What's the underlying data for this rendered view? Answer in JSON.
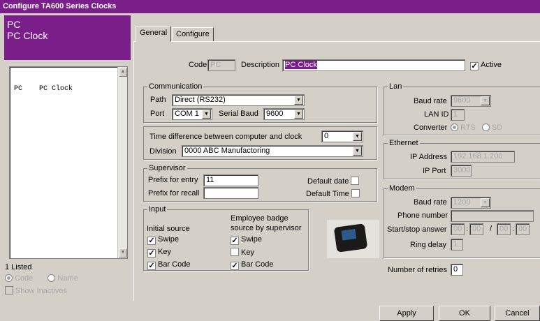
{
  "title": "Configure TA600 Series Clocks",
  "header": {
    "line1": "PC",
    "line2": "PC Clock"
  },
  "list": {
    "items": [
      "PC    PC Clock"
    ]
  },
  "left": {
    "listed": "1 Listed",
    "sort_code": "Code",
    "sort_name": "Name",
    "show_inactives": "Show Inactives"
  },
  "tabs": [
    "General",
    "Configure"
  ],
  "general": {
    "code_label": "Code",
    "code_value": "PC",
    "desc_label": "Description",
    "desc_value": "PC Clock",
    "active_label": "Active",
    "communication": {
      "title": "Communication",
      "path_label": "Path",
      "path_value": "Direct (RS232)",
      "port_label": "Port",
      "port_value": "COM 1",
      "baud_label": "Serial Baud",
      "baud_value": "9600"
    },
    "time": {
      "diff_label": "Time difference between computer and clock",
      "diff_value": "0",
      "division_label": "Division",
      "division_value": "0000  ABC Manufactoring"
    },
    "supervisor": {
      "title": "Supervisor",
      "entry_label": "Prefix for entry",
      "entry_value": "11",
      "recall_label": "Prefix for recall",
      "recall_value": "",
      "default_date": "Default date",
      "default_time": "Default Time"
    },
    "input": {
      "title": "Input",
      "initial_label": "Initial source",
      "badge_label1": "Employee badge",
      "badge_label2": "source by supervisor",
      "initial": [
        {
          "label": "Swipe",
          "checked": true
        },
        {
          "label": "Key",
          "checked": true
        },
        {
          "label": "Bar Code",
          "checked": true
        }
      ],
      "supervisor": [
        {
          "label": "Swipe",
          "checked": true
        },
        {
          "label": "Key",
          "checked": false
        },
        {
          "label": "Bar Code",
          "checked": true
        }
      ]
    },
    "lan": {
      "title": "Lan",
      "baud_label": "Baud rate",
      "baud_value": "9600",
      "id_label": "LAN ID",
      "id_value": "1",
      "conv_label": "Converter",
      "conv_rts": "RTS",
      "conv_sd": "SD"
    },
    "ethernet": {
      "title": "Ethernet",
      "ip_label": "IP Address",
      "ip_value": "192.168.1.200",
      "port_label": "IP Port",
      "port_value": "3000"
    },
    "modem": {
      "title": "Modem",
      "baud_label": "Baud rate",
      "baud_value": "1200",
      "phone_label": "Phone number",
      "phone_value": "",
      "ss_label": "Start/stop answer",
      "ss_h1": "00",
      "ss_m1": "00",
      "ss_sep": "/",
      "ss_h2": "00",
      "ss_m2": "00",
      "ring_label": "Ring delay",
      "ring_value": "1"
    },
    "retries_label": "Number of retries",
    "retries_value": "0"
  },
  "buttons": {
    "apply": "Apply",
    "ok": "OK",
    "cancel": "Cancel"
  }
}
